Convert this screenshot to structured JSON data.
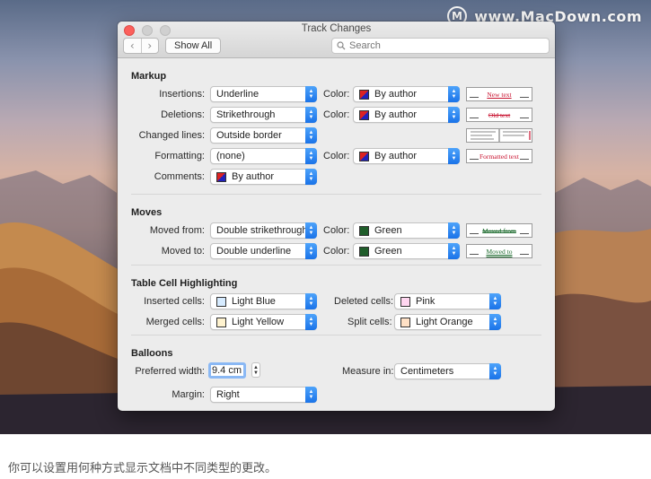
{
  "watermark": {
    "logo": "M",
    "text": "www.MacDown.com"
  },
  "window": {
    "title": "Track Changes",
    "nav": {
      "back": "‹",
      "forward": "›"
    },
    "show_all": "Show All",
    "search_placeholder": "Search"
  },
  "markup": {
    "heading": "Markup",
    "color_label": "Color:",
    "insertions": {
      "label": "Insertions:",
      "value": "Underline",
      "color": "By author",
      "preview": "New text"
    },
    "deletions": {
      "label": "Deletions:",
      "value": "Strikethrough",
      "color": "By author",
      "preview": "Old text"
    },
    "changed_lines": {
      "label": "Changed lines:",
      "value": "Outside border"
    },
    "formatting": {
      "label": "Formatting:",
      "value": "(none)",
      "color": "By author",
      "preview": "Formatted text"
    },
    "comments": {
      "label": "Comments:",
      "value": "By author"
    }
  },
  "moves": {
    "heading": "Moves",
    "color_label": "Color:",
    "moved_from": {
      "label": "Moved from:",
      "value": "Double strikethrough",
      "color": "Green",
      "color_hex": "#1f5d2a",
      "preview": "Moved from"
    },
    "moved_to": {
      "label": "Moved to:",
      "value": "Double underline",
      "color": "Green",
      "color_hex": "#1f5d2a",
      "preview": "Moved to"
    }
  },
  "table_cells": {
    "heading": "Table Cell Highlighting",
    "inserted": {
      "label": "Inserted cells:",
      "value": "Light Blue",
      "hex": "#d6ebff"
    },
    "deleted": {
      "label": "Deleted cells:",
      "value": "Pink",
      "hex": "#ffd6f0"
    },
    "merged": {
      "label": "Merged cells:",
      "value": "Light Yellow",
      "hex": "#fff3cf"
    },
    "split": {
      "label": "Split cells:",
      "value": "Light Orange",
      "hex": "#ffe1c6"
    }
  },
  "balloons": {
    "heading": "Balloons",
    "preferred_width": {
      "label": "Preferred width:",
      "value": "9.4 cm"
    },
    "measure_in": {
      "label": "Measure in:",
      "value": "Centimeters"
    },
    "margin": {
      "label": "Margin:",
      "value": "Right"
    }
  },
  "caption": "你可以设置用何种方式显示文档中不同类型的更改。"
}
